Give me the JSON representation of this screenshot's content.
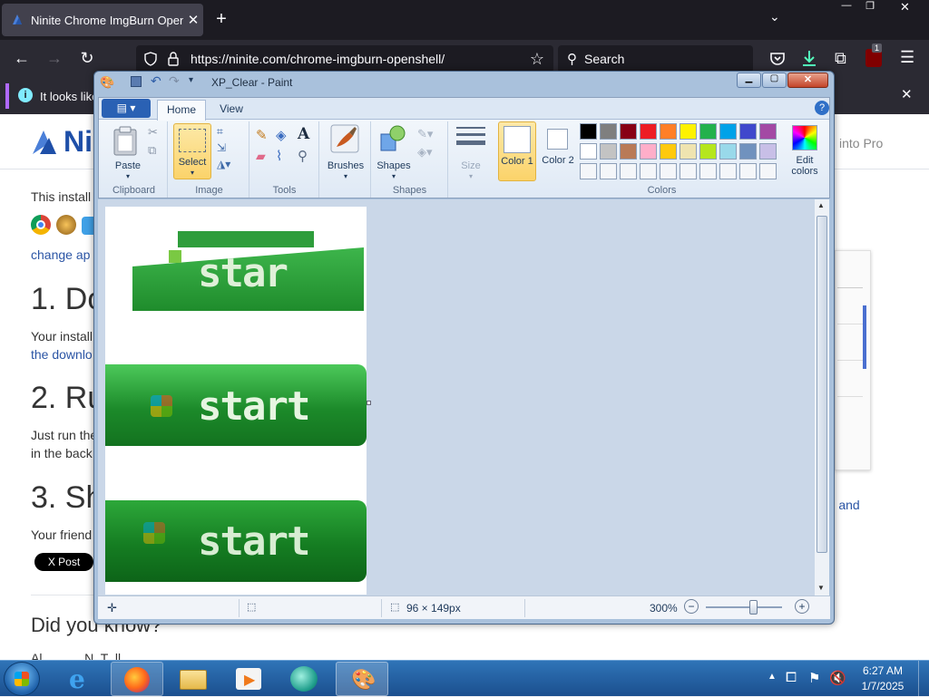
{
  "browser": {
    "tab_title": "Ninite Chrome ImgBurn Open",
    "url": "https://ninite.com/chrome-imgburn-openshell/",
    "search_placeholder": "Search",
    "notification": "It looks like",
    "extension_badge": "1"
  },
  "page": {
    "logo_text": "Ni",
    "nav_right": "into Pro",
    "intro": "This install",
    "change_link": "change ap",
    "h1": "1. Do",
    "p1": "Your install",
    "p1_link": "the downlo",
    "h2": "2. Ru",
    "p2a": "Just run the",
    "p2b": "in the back",
    "h3": "3. Sh",
    "p3": "Your friend",
    "right_link": "re and",
    "post_button": "X Post",
    "did_you_know": "Did you know?",
    "bottom_partial": "Al            N  T  ll"
  },
  "paint": {
    "title": "XP_Clear - Paint",
    "tabs": [
      "Home",
      "View"
    ],
    "groups": {
      "clipboard": "Clipboard",
      "image": "Image",
      "tools": "Tools",
      "shapes": "Shapes",
      "colors": "Colors"
    },
    "buttons": {
      "paste": "Paste",
      "select": "Select",
      "brushes": "Brushes",
      "shapes": "Shapes",
      "size": "Size",
      "color1": "Color 1",
      "color2": "Color 2",
      "edit_colors": "Edit colors"
    },
    "palette_row1": [
      "#000000",
      "#7f7f7f",
      "#880015",
      "#ed1c24",
      "#ff7f27",
      "#fff200",
      "#22b14c",
      "#00a2e8",
      "#3f48cc",
      "#a349a4"
    ],
    "palette_row2": [
      "#ffffff",
      "#c3c3c3",
      "#b97a57",
      "#ffaec9",
      "#ffc90e",
      "#efe4b0",
      "#b5e61d",
      "#99d9ea",
      "#7092be",
      "#c8bfe7"
    ],
    "status": {
      "size": "96 × 149px",
      "zoom": "300%"
    },
    "canvas_text": "start",
    "canvas_partial": "star"
  },
  "taskbar": {
    "time": "6:27 AM",
    "date": "1/7/2025"
  }
}
